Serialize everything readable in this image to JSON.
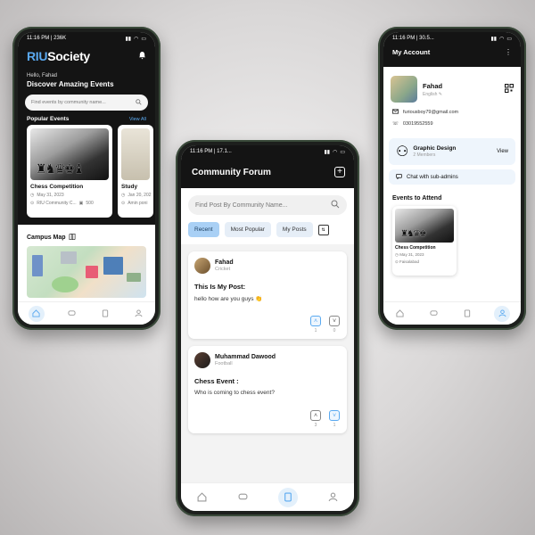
{
  "left": {
    "status_time": "11:16 PM | 236K",
    "logo_prefix": "RIU",
    "logo_suffix": "Society",
    "greeting_small": "Hello, Fahad",
    "greeting_big": "Discover Amazing Events",
    "search_placeholder": "Find events by community name...",
    "popular_label": "Popular Events",
    "view_all": "View All",
    "events": [
      {
        "title": "Chess Competition",
        "date": "May 31, 2023",
        "location": "RIU Community C...",
        "count": "500"
      },
      {
        "title": "Study",
        "date": "Jan 20, 202",
        "location": "Amin poni"
      }
    ],
    "campus_map_label": "Campus Map"
  },
  "center": {
    "status_time": "11:16 PM | 17.1...",
    "title": "Community Forum",
    "search_placeholder": "Find Post By Community Name...",
    "filters": [
      "Recent",
      "Most Popular",
      "My Posts"
    ],
    "posts": [
      {
        "author": "Fahad",
        "category": "Cricket",
        "title": "This Is My Post:",
        "text": "hello how are you guys 👏",
        "up": "1",
        "down": "0"
      },
      {
        "author": "Muhammad Dawood",
        "category": "Football",
        "title": "Chess Event :",
        "text": "Who is coming to chess event?",
        "up": "3",
        "down": "1"
      }
    ]
  },
  "right": {
    "status_time": "11:16 PM | 30.5...",
    "title": "My Account",
    "name": "Fahad",
    "language": "English",
    "email": "furiousboy79@gmail.com",
    "phone": "03019552559",
    "group_name": "Graphic Design",
    "group_members": "2 Members",
    "view_label": "View",
    "chat_label": "Chat with sub-admins",
    "attend_label": "Events to Attend",
    "attend_event": {
      "title": "Chess Competition",
      "date": "May 31, 2023",
      "location": "Faisalabad"
    }
  },
  "colors": {
    "accent": "#5aa9f0",
    "dark": "#141414",
    "chip_active": "#a9d0f5"
  }
}
